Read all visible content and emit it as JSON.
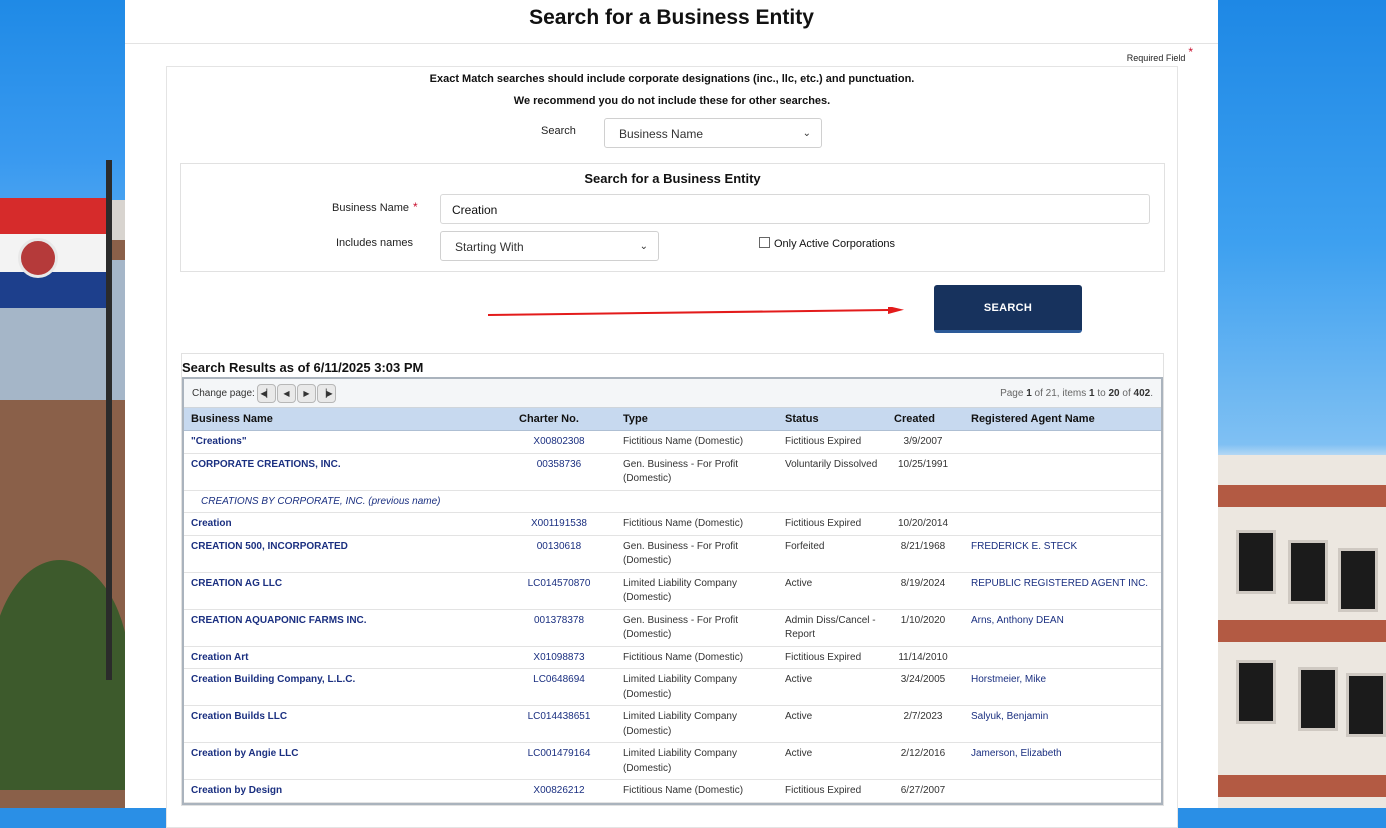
{
  "page": {
    "title": "Search for a Business Entity",
    "required_field_label": "Required Field",
    "required_star": "*"
  },
  "notes": {
    "line1": "Exact Match searches should include corporate designations (inc., llc, etc.) and punctuation.",
    "line2": "We recommend you do not include these for other searches."
  },
  "search_type": {
    "label": "Search",
    "value": "Business Name"
  },
  "form": {
    "title": "Search for a Business Entity",
    "business_name_label": "Business Name",
    "business_name_value": "Creation",
    "includes_label": "Includes names",
    "includes_value": "Starting With",
    "active_only_label": "Only Active Corporations",
    "search_button": "SEARCH"
  },
  "results": {
    "title": "Search Results as of 6/11/2025 3:03 PM",
    "pager": {
      "change_page_label": "Change page:",
      "info_prefix": "Page ",
      "page": "1",
      "info_mid1": " of 21, items ",
      "from": "1",
      "info_mid2": " to ",
      "to": "20",
      "info_mid3": " of ",
      "total": "402",
      "info_suffix": "."
    },
    "columns": [
      "Business Name",
      "Charter No.",
      "Type",
      "Status",
      "Created",
      "Registered Agent Name"
    ],
    "rows": [
      {
        "name": "\"Creations\"",
        "charter": "X00802308",
        "type": "Fictitious Name (Domestic)",
        "status": "Fictitious Expired",
        "created": "3/9/2007",
        "agent": ""
      },
      {
        "name": "CORPORATE CREATIONS, INC.",
        "charter": "00358736",
        "type": "Gen. Business - For Profit (Domestic)",
        "status": "Voluntarily Dissolved",
        "created": "10/25/1991",
        "agent": "",
        "previous": "CREATIONS BY CORPORATE, INC. (previous name)"
      },
      {
        "name": "Creation",
        "charter": "X001191538",
        "type": "Fictitious Name (Domestic)",
        "status": "Fictitious Expired",
        "created": "10/20/2014",
        "agent": ""
      },
      {
        "name": "CREATION 500, INCORPORATED",
        "charter": "00130618",
        "type": "Gen. Business - For Profit (Domestic)",
        "status": "Forfeited",
        "created": "8/21/1968",
        "agent": "FREDERICK E. STECK"
      },
      {
        "name": "CREATION AG LLC",
        "charter": "LC014570870",
        "type": "Limited Liability Company (Domestic)",
        "status": "Active",
        "created": "8/19/2024",
        "agent": "REPUBLIC REGISTERED AGENT INC."
      },
      {
        "name": "CREATION AQUAPONIC FARMS INC.",
        "charter": "001378378",
        "type": "Gen. Business - For Profit (Domestic)",
        "status": "Admin Diss/Cancel - Report",
        "created": "1/10/2020",
        "agent": "Arns, Anthony DEAN"
      },
      {
        "name": "Creation Art",
        "charter": "X01098873",
        "type": "Fictitious Name (Domestic)",
        "status": "Fictitious Expired",
        "created": "11/14/2010",
        "agent": ""
      },
      {
        "name": "Creation Building Company, L.L.C.",
        "charter": "LC0648694",
        "type": "Limited Liability Company (Domestic)",
        "status": "Active",
        "created": "3/24/2005",
        "agent": "Horstmeier, Mike"
      },
      {
        "name": "Creation Builds LLC",
        "charter": "LC014438651",
        "type": "Limited Liability Company (Domestic)",
        "status": "Active",
        "created": "2/7/2023",
        "agent": "Salyuk, Benjamin"
      },
      {
        "name": "Creation by Angie LLC",
        "charter": "LC001479164",
        "type": "Limited Liability Company (Domestic)",
        "status": "Active",
        "created": "2/12/2016",
        "agent": "Jamerson, Elizabeth"
      },
      {
        "name": "Creation by Design",
        "charter": "X00826212",
        "type": "Fictitious Name (Domestic)",
        "status": "Fictitious Expired",
        "created": "6/27/2007",
        "agent": ""
      }
    ]
  },
  "colors": {
    "button": "#17325d",
    "link": "#1a2f80",
    "header_row": "#c7d9ef",
    "required": "#c8102e",
    "arrow": "#e31b1b"
  }
}
